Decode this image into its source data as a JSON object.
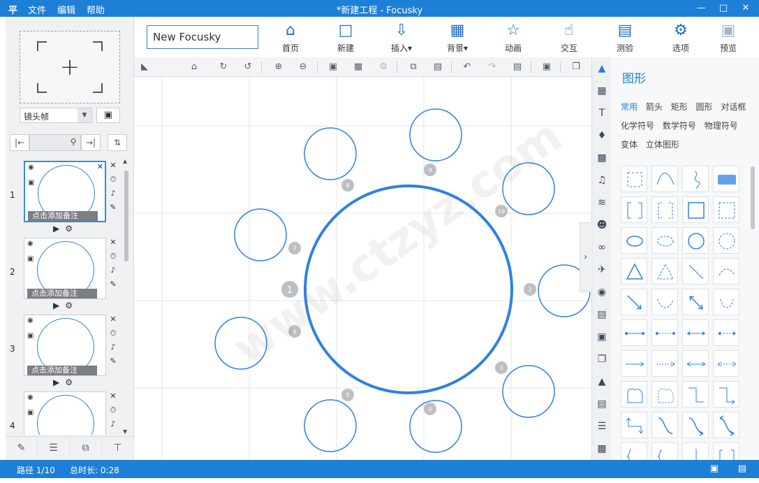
{
  "titlebar": {
    "app_icon": "平",
    "menu": [
      "文件",
      "编辑",
      "帮助"
    ],
    "title": "*新建工程 - Focusky",
    "window_buttons": [
      "minimize-icon",
      "maximize-icon",
      "close-icon"
    ]
  },
  "left_panel": {
    "add_frame_symbol": "+",
    "frame_type": "镜头帧",
    "slides": [
      {
        "number": "1",
        "note": "点击添加备注"
      },
      {
        "number": "2",
        "note": "点击添加备注"
      },
      {
        "number": "3",
        "note": "点击添加备注"
      },
      {
        "number": "4",
        "note": ""
      }
    ]
  },
  "toolbar": {
    "project_name": "New Focusky",
    "buttons": [
      {
        "label": "首页",
        "icon": "home-icon"
      },
      {
        "label": "新建",
        "icon": "new-frame-icon"
      },
      {
        "label": "插入▾",
        "icon": "insert-icon"
      },
      {
        "label": "背景▾",
        "icon": "background-icon"
      },
      {
        "label": "动画",
        "icon": "animation-icon"
      },
      {
        "label": "交互",
        "icon": "interaction-icon"
      },
      {
        "label": "测验",
        "icon": "quiz-icon"
      },
      {
        "label": "选项",
        "icon": "settings-icon"
      },
      {
        "label": "预览",
        "icon": "preview-icon"
      }
    ]
  },
  "canvas": {
    "watermark": "www.ctzyz.com",
    "path_numbers": [
      "1",
      "2",
      "3",
      "4",
      "5",
      "6",
      "7",
      "8",
      "9",
      "10"
    ],
    "accent": "#2f80e4"
  },
  "shapes_panel": {
    "title": "图形",
    "categories": [
      "常用",
      "箭头",
      "矩形",
      "圆形",
      "对话框",
      "化学符号",
      "数学符号",
      "物理符号",
      "变体",
      "立体图形"
    ],
    "active_category": "常用"
  },
  "statusbar": {
    "path": "路径 1/10",
    "duration": "总时长: 0:28"
  },
  "colors": {
    "brand": "#1e7fd6",
    "shape_stroke": "#2f80e4"
  }
}
